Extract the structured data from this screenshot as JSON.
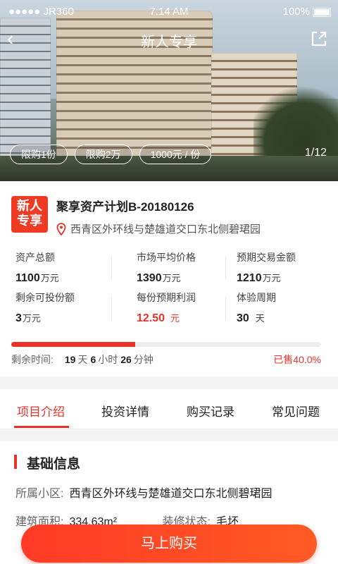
{
  "status_bar": {
    "carrier": "●●●●● JR360",
    "time": "7:14 AM",
    "battery": "100%"
  },
  "nav": {
    "title": "新人专享"
  },
  "hero": {
    "chips": [
      "限购1份",
      "限购2万",
      "1000元 / 份"
    ],
    "counter": "1/12"
  },
  "project": {
    "badge": "新人专享",
    "badge_line1": "新人",
    "badge_line2": "专享",
    "name": "聚享资产计划B-20180126",
    "location": "西青区外环线与楚雄道交口东北侧碧珺园",
    "stats": [
      {
        "label": "资产总额",
        "value": "1100",
        "unit": "万元"
      },
      {
        "label": "市场平均价格",
        "value": "1390",
        "unit": "万元"
      },
      {
        "label": "预期交易金额",
        "value": "1210",
        "unit": "万元"
      },
      {
        "label": "剩余可投份额",
        "value": "3",
        "unit": "万元"
      },
      {
        "label": "每份预期利润",
        "value": "12.50",
        "unit": "元"
      },
      {
        "label": "体验周期",
        "value": "30",
        "unit": "天"
      }
    ],
    "progress_percent": 40,
    "remaining_label": "剩余时间:",
    "remaining": {
      "days": "19",
      "days_unit": "天",
      "hours": "6",
      "hours_unit": "小时",
      "minutes": "26",
      "minutes_unit": "分钟"
    },
    "sold": "已售40.0%"
  },
  "tabs": [
    "项目介绍",
    "投资详情",
    "购买记录",
    "常见问题"
  ],
  "basic_info": {
    "title": "基础信息",
    "community_label": "所属小区:",
    "community_value": "西青区外环线与楚雄道交口东北侧碧珺园",
    "area_label": "建筑面积:",
    "area_value": "334.63m²",
    "decoration_label": "装修状态:",
    "decoration_value": "毛坯"
  },
  "buy_button": "马上购买",
  "colors": {
    "accent": "#e8332a",
    "button": "#ff3a26"
  }
}
